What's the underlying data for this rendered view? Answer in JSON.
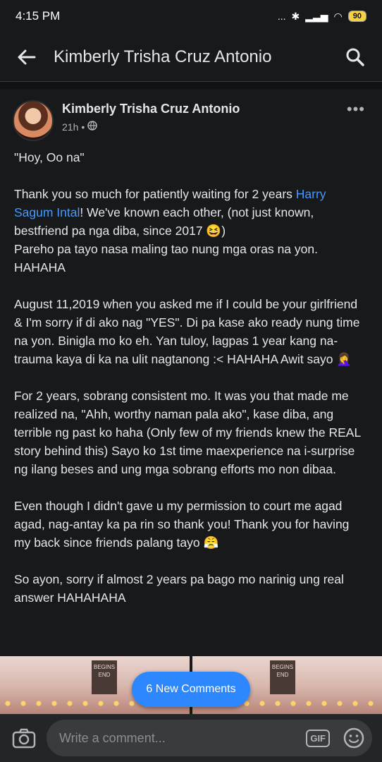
{
  "status_bar": {
    "time": "4:15 PM",
    "signal": "...",
    "battery": "90"
  },
  "header": {
    "title": "Kimberly Trisha Cruz Antonio",
    "back_icon": "arrow-left-icon",
    "search_icon": "search-icon"
  },
  "post": {
    "author": "Kimberly Trisha Cruz Antonio",
    "time": "21h",
    "time_separator": "•",
    "paragraphs": [
      {
        "text": "\"Hoy, Oo na\""
      },
      {
        "pre": "Thank you so much for patiently waiting for 2 years ",
        "mention": "Harry Sagum Intal",
        "post": "! We've known each other, (not just known, bestfriend pa nga diba, since 2017 😆)\nPareho pa tayo nasa maling tao nung mga oras na yon. HAHAHA"
      },
      {
        "text": "August 11,2019 when you asked me if I could be your girlfriend & I'm sorry if di ako nag \"YES\". Di pa kase ako ready nung time na yon. Biniglа mo ko eh. Yan tuloy, lagpas 1 year kang na-trauma kaya di ka na ulit nagtanong :< HAHAHA Awit sayo 🤦‍♀️"
      },
      {
        "text": "For 2 years, sobrang consistent mo. It was you that made me realized na, \"Ahh, worthy naman pala ako\", kase diba, ang terrible ng past ko haha (Only few of my friends knew the REAL story behind this) Sayo ko 1st time maexperience na i-surprise ng ilang beses and ung mga sobrang efforts mo non dibaa."
      },
      {
        "text": "Even though I  didn't gave u my permission to court me agad agad, nag-antay ka pa rin so thank you! Thank you for having my back since friends palang tayo 😤"
      },
      {
        "text": "So ayon, sorry if almost 2 years pa bago mo narinig ung real answer HAHAHAHA"
      }
    ],
    "photo_sign_text": "BEGINS END"
  },
  "new_comments_label": "6 New Comments",
  "comment_bar": {
    "placeholder": "Write a comment...",
    "gif_label": "GIF"
  },
  "colors": {
    "background": "#18191a",
    "accent": "#2d88ff",
    "mention": "#4599ff"
  }
}
